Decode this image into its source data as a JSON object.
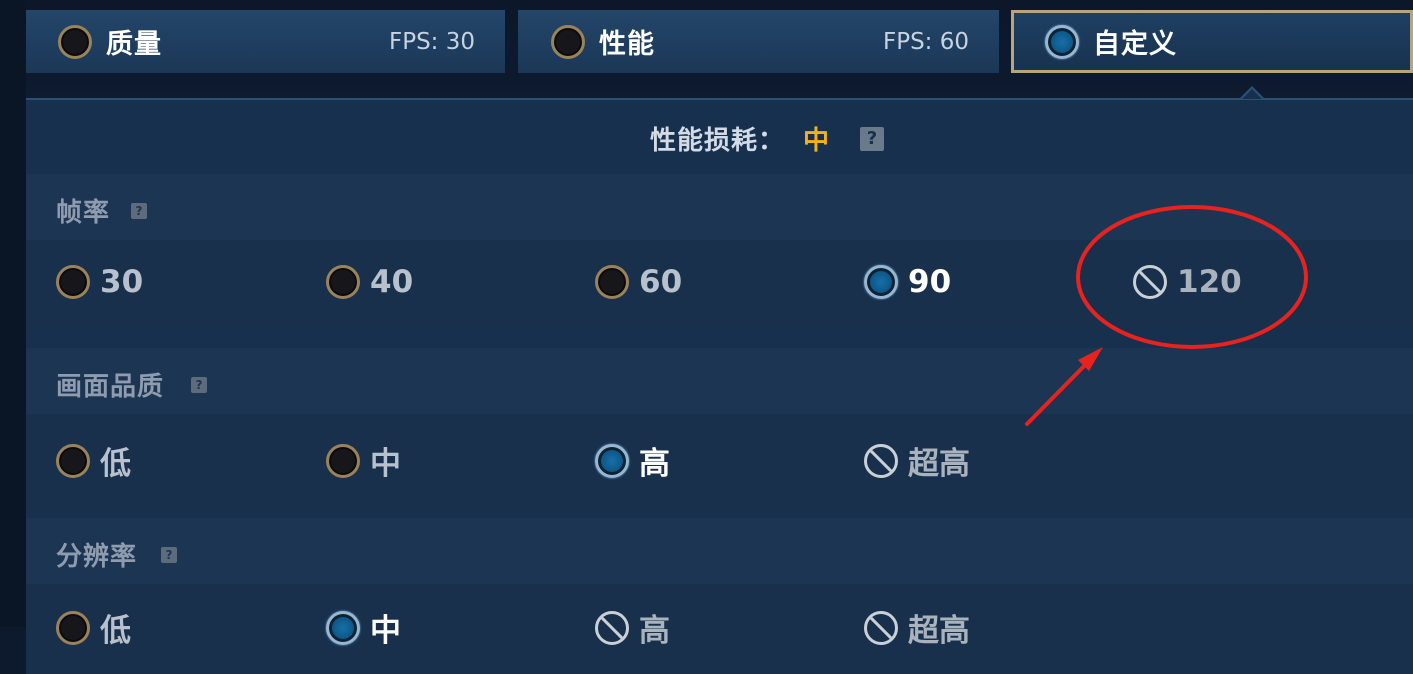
{
  "presets": [
    {
      "name": "质量",
      "fps": "FPS: 30",
      "state": "unselected"
    },
    {
      "name": "性能",
      "fps": "FPS: 60",
      "state": "unselected"
    },
    {
      "name": "自定义",
      "fps": "",
      "state": "selected"
    }
  ],
  "performance_cost": {
    "label": "性能损耗：",
    "value": "中",
    "help": "?"
  },
  "sections": [
    {
      "title": "帧率",
      "help": "?",
      "options": [
        {
          "label": "30",
          "state": "unselected"
        },
        {
          "label": "40",
          "state": "unselected"
        },
        {
          "label": "60",
          "state": "unselected"
        },
        {
          "label": "90",
          "state": "selected"
        },
        {
          "label": "120",
          "state": "disabled"
        }
      ]
    },
    {
      "title": "画面品质",
      "help": "?",
      "options": [
        {
          "label": "低",
          "state": "unselected"
        },
        {
          "label": "中",
          "state": "unselected"
        },
        {
          "label": "高",
          "state": "selected"
        },
        {
          "label": "超高",
          "state": "disabled"
        }
      ]
    },
    {
      "title": "分辨率",
      "help": "?",
      "options": [
        {
          "label": "低",
          "state": "unselected"
        },
        {
          "label": "中",
          "state": "selected"
        },
        {
          "label": "高",
          "state": "disabled"
        },
        {
          "label": "超高",
          "state": "disabled"
        }
      ]
    }
  ],
  "colors": {
    "accent_gold": "#f2b319",
    "selected_border": "#b9a57a",
    "annotation_red": "#e8231f"
  },
  "annotation": {
    "target": "120",
    "shapes": [
      "ellipse",
      "arrow"
    ]
  }
}
